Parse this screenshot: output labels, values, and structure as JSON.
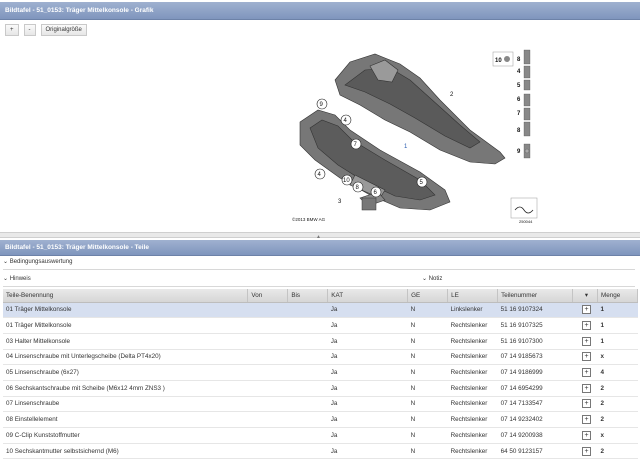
{
  "top_panel": {
    "title": "Bildtafel - 51_0153: Träger Mittelkonsole - Grafik",
    "zoom_in_label": "+",
    "zoom_out_label": "-",
    "original_size_label": "Originalgröße"
  },
  "diagram": {
    "copyright": "©2013 BMW AG",
    "image_id": "250044",
    "callouts": [
      "2",
      "9",
      "4",
      "7",
      "1",
      "4",
      "10",
      "8",
      "5",
      "3",
      "6"
    ],
    "legend_numbers": [
      "10",
      "8",
      "4",
      "5",
      "6",
      "7",
      "8",
      "9"
    ]
  },
  "bottom_panel": {
    "title": "Bildtafel - 51_0153: Träger Mittelkonsole - Teile",
    "condition_label": "Bedingungsauswertung",
    "hint_label": "Hinweis",
    "note_label": "Notiz"
  },
  "table": {
    "headers": [
      "Teile-Benennung",
      "Von",
      "Bis",
      "KAT",
      "GE",
      "LE",
      "Teilenummer",
      "",
      "Menge"
    ],
    "rows": [
      {
        "name": "01 Träger Mittelkonsole",
        "von": "",
        "bis": "",
        "kat": "Ja",
        "ge": "N",
        "le": "Linkslenker",
        "nr": "51 16 9107324",
        "qty": "1"
      },
      {
        "name": "01 Träger Mittelkonsole",
        "von": "",
        "bis": "",
        "kat": "Ja",
        "ge": "N",
        "le": "Rechtslenker",
        "nr": "51 16 9107325",
        "qty": "1"
      },
      {
        "name": "03 Halter Mittelkonsole",
        "von": "",
        "bis": "",
        "kat": "Ja",
        "ge": "N",
        "le": "Rechtslenker",
        "nr": "51 16 9107300",
        "qty": "1"
      },
      {
        "name": "04 Linsenschraube mit Unterlegscheibe (Delta PT4x20)",
        "von": "",
        "bis": "",
        "kat": "Ja",
        "ge": "N",
        "le": "Rechtslenker",
        "nr": "07 14 9185673",
        "qty": "x"
      },
      {
        "name": "05 Linsenschraube (6x27)",
        "von": "",
        "bis": "",
        "kat": "Ja",
        "ge": "N",
        "le": "Rechtslenker",
        "nr": "07 14 9186999",
        "qty": "4"
      },
      {
        "name": "06 Sechskantschraube mit Scheibe (M6x12 4mm ZNS3 )",
        "von": "",
        "bis": "",
        "kat": "Ja",
        "ge": "N",
        "le": "Rechtslenker",
        "nr": "07 14 6954299",
        "qty": "2"
      },
      {
        "name": "07 Linsenschraube",
        "von": "",
        "bis": "",
        "kat": "Ja",
        "ge": "N",
        "le": "Rechtslenker",
        "nr": "07 14 7133547",
        "qty": "2"
      },
      {
        "name": "08 Einstellelement",
        "von": "",
        "bis": "",
        "kat": "Ja",
        "ge": "N",
        "le": "Rechtslenker",
        "nr": "07 14 9232402",
        "qty": "2"
      },
      {
        "name": "09 C-Clip Kunststoffmutter",
        "von": "",
        "bis": "",
        "kat": "Ja",
        "ge": "N",
        "le": "Rechtslenker",
        "nr": "07 14 9200938",
        "qty": "x"
      },
      {
        "name": "10 Sechskantmutter selbstsichernd (M6)",
        "von": "",
        "bis": "",
        "kat": "Ja",
        "ge": "N",
        "le": "Rechtslenker",
        "nr": "64 50 9123157",
        "qty": "2"
      }
    ]
  }
}
